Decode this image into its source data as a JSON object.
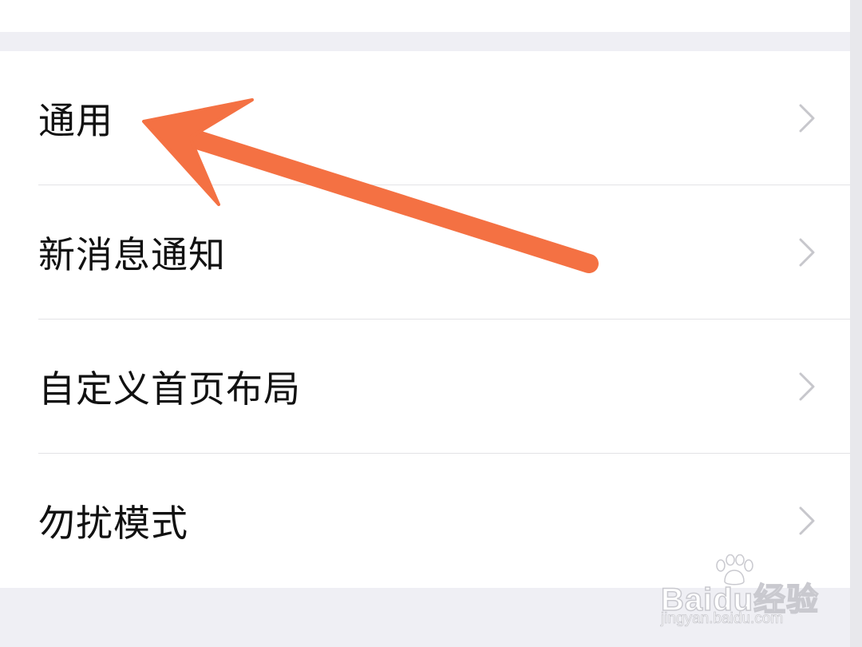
{
  "settings": {
    "items": [
      {
        "label": "通用",
        "icon": "chevron-right-icon"
      },
      {
        "label": "新消息通知",
        "icon": "chevron-right-icon"
      },
      {
        "label": "自定义首页布局",
        "icon": "chevron-right-icon"
      },
      {
        "label": "勿扰模式",
        "icon": "chevron-right-icon"
      }
    ]
  },
  "watermark": {
    "main": "Baidu经验",
    "sub": "jingyan.baidu.com"
  },
  "colors": {
    "page_background": "#efeff4",
    "row_background": "#ffffff",
    "text": "#111111",
    "chevron": "#c7c7cc",
    "divider": "#e3e3e6",
    "annotation_arrow": "#f47143"
  }
}
